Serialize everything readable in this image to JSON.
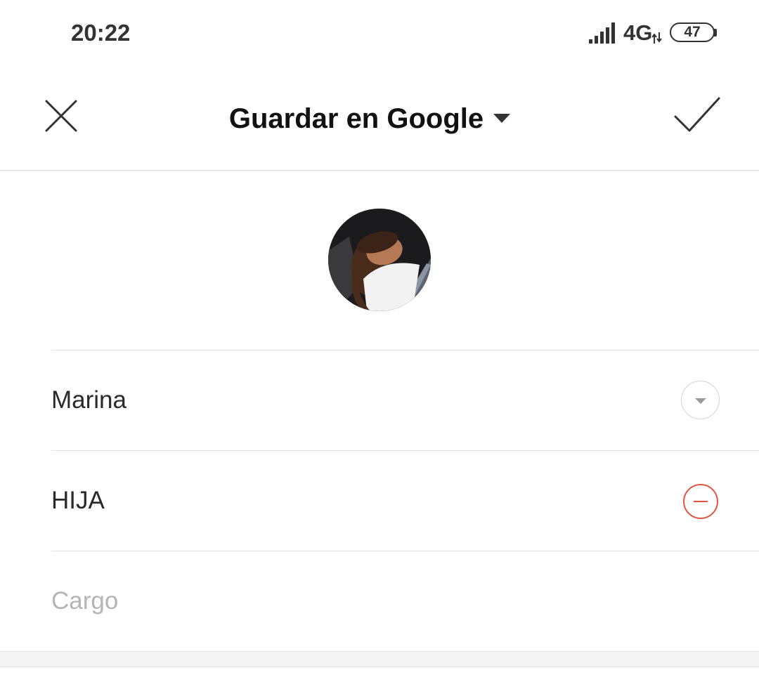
{
  "status_bar": {
    "time": "20:22",
    "network": "4G",
    "battery": "47",
    "icons": [
      "signal-icon",
      "data-arrows-icon",
      "battery-icon"
    ]
  },
  "header": {
    "title": "Guardar en Google",
    "close_icon": "close-icon",
    "confirm_icon": "check-icon",
    "dropdown_icon": "caret-down-icon"
  },
  "form": {
    "avatar_icon": "contact-photo",
    "name_value": "Marina",
    "relation_value": "HIJA",
    "job_placeholder": "Cargo"
  },
  "colors": {
    "remove_accent": "#e35540",
    "divider": "#e2e2e2",
    "placeholder": "#b5b5b5"
  }
}
